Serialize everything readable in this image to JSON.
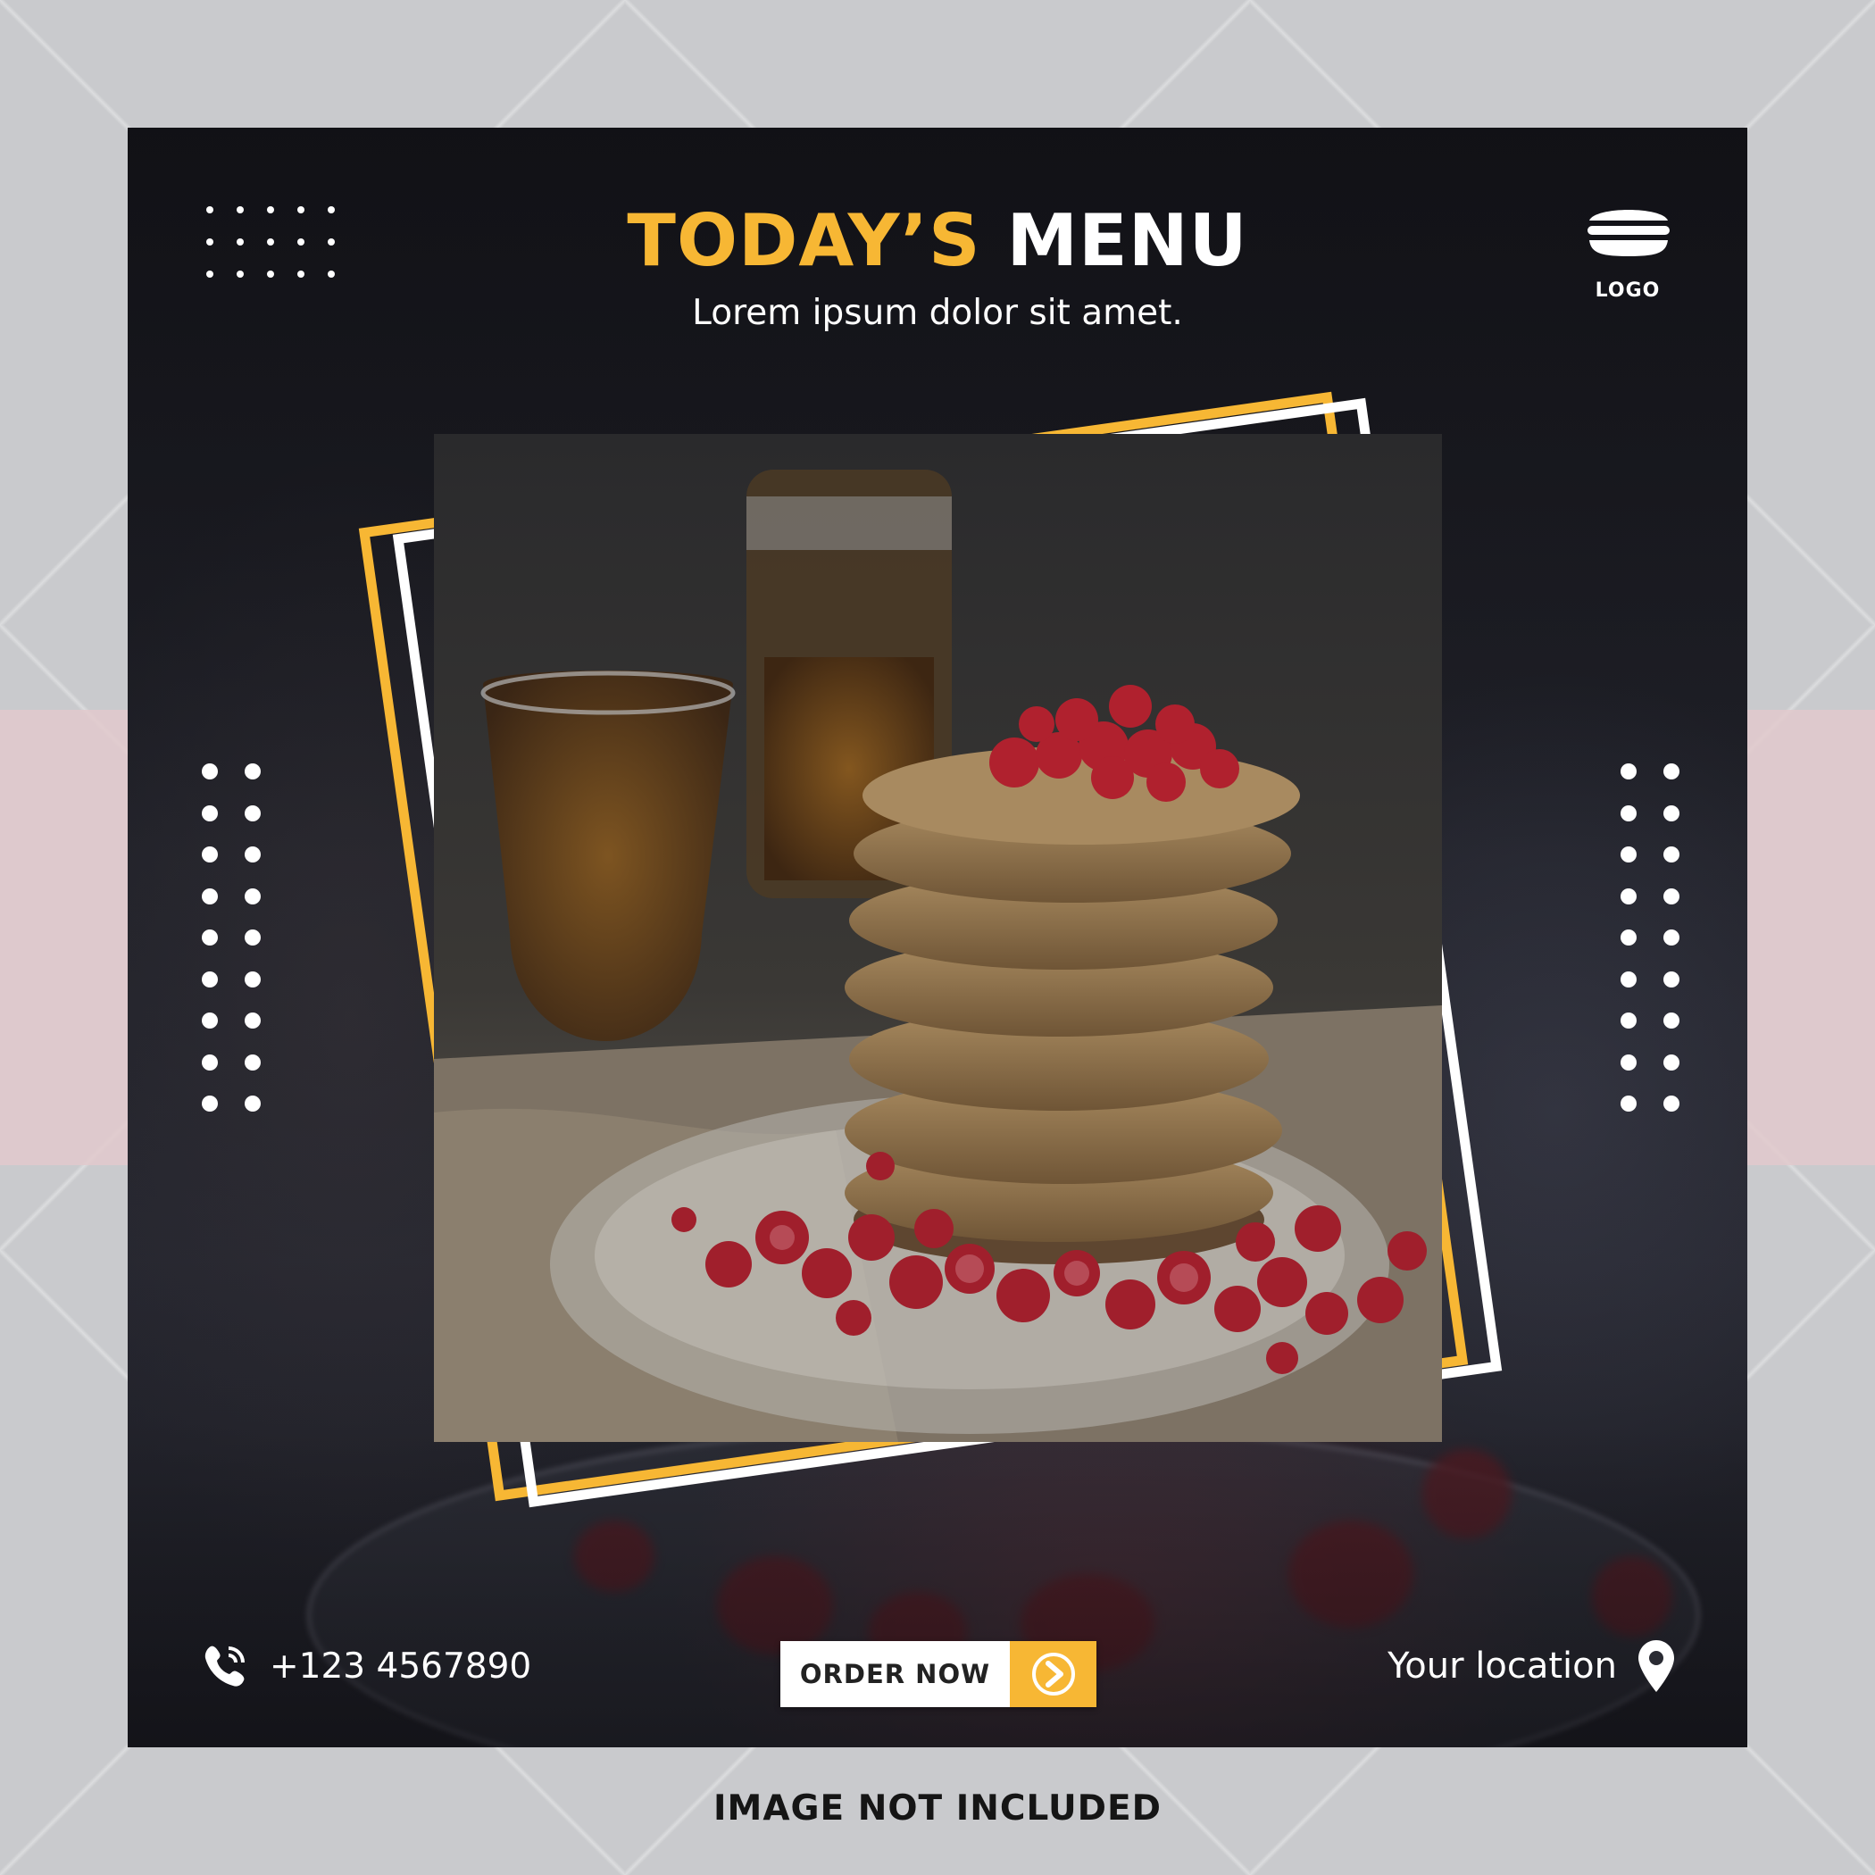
{
  "post": {
    "title_part1": "TODAY’S",
    "title_part2": "MENU",
    "subtitle": "Lorem ipsum dolor sit amet.",
    "logo_label": "LOGO",
    "phone": "+123 4567890",
    "order_button": "ORDER NOW",
    "location": "Your location"
  },
  "caption": "IMAGE NOT INCLUDED",
  "colors": {
    "accent": "#f7b734",
    "card_bg": "#1f2027",
    "page_bg": "#c9cacd",
    "text_light": "#ffffff"
  },
  "icons": {
    "logo": "burger-logo-icon",
    "phone": "phone-icon",
    "order": "arrow-circle-icon",
    "location": "map-pin-icon"
  }
}
